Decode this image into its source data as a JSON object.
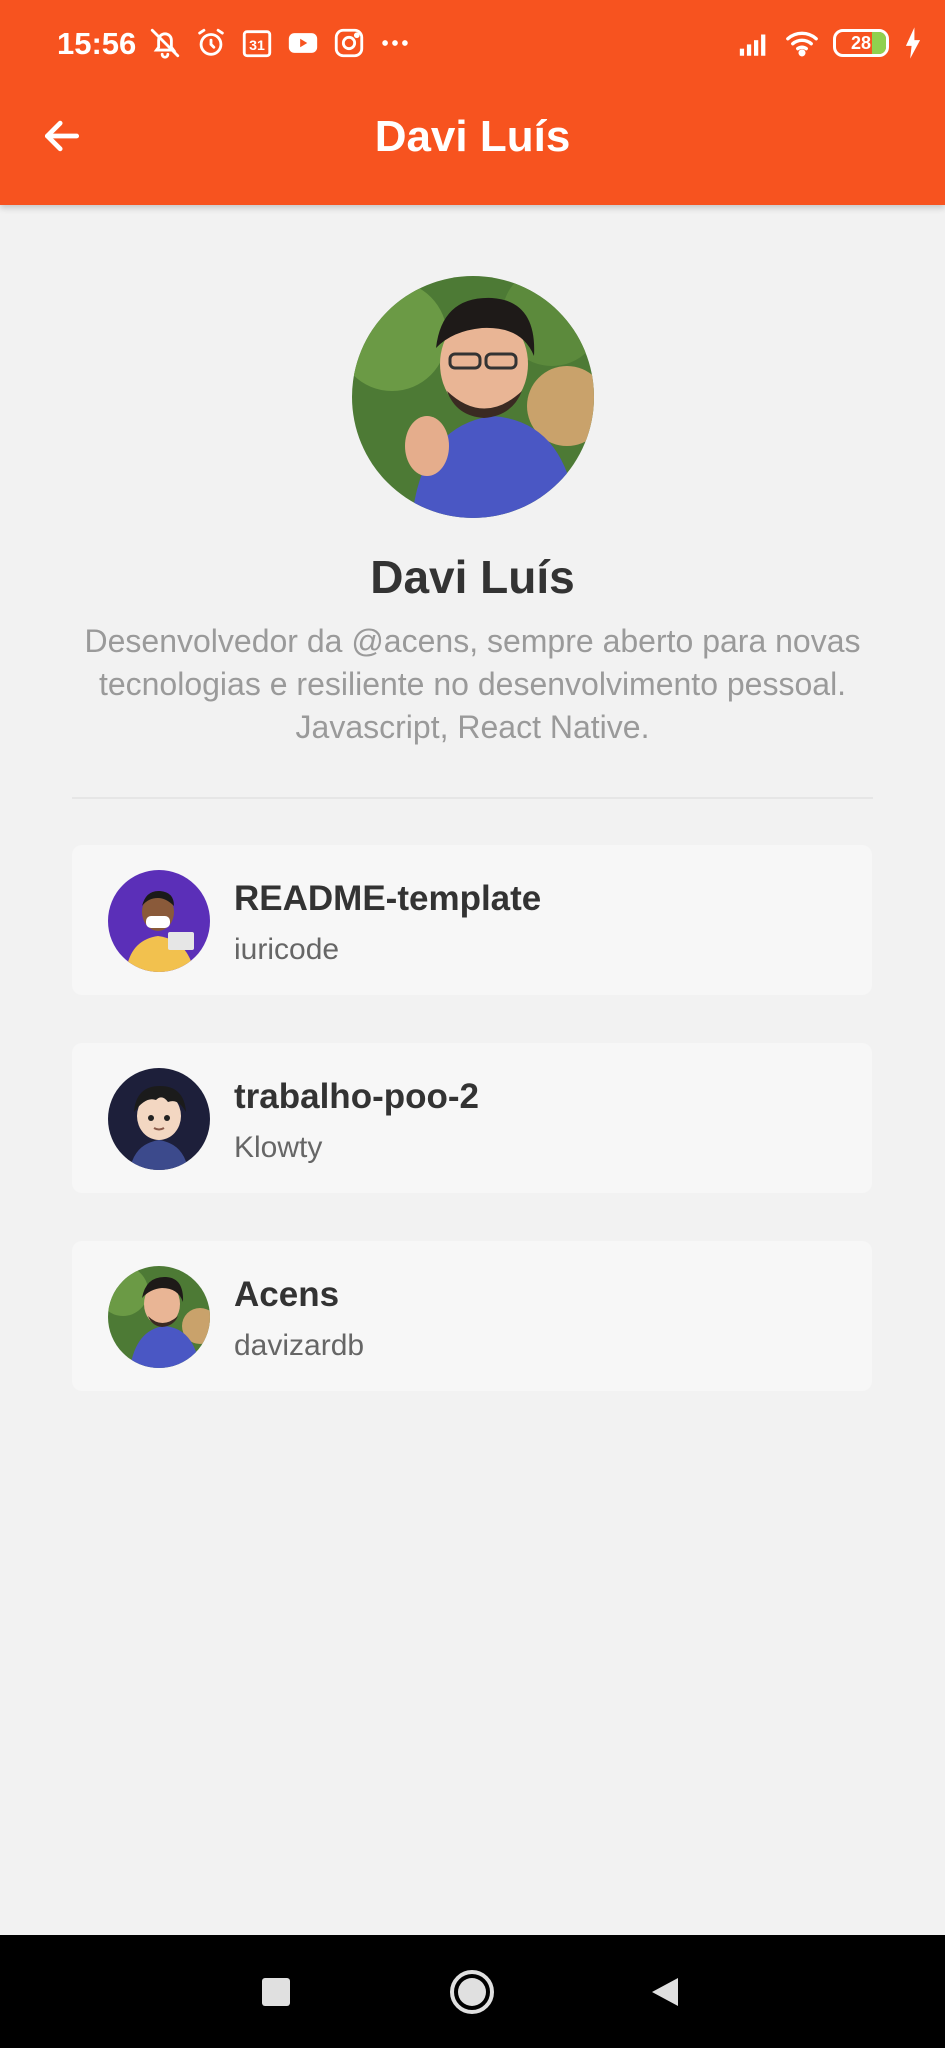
{
  "status_bar": {
    "time": "15:56",
    "left_icons": [
      "bell-off-icon",
      "alarm-icon",
      "calendar-icon",
      "youtube-icon",
      "instagram-icon",
      "more-dots-icon"
    ],
    "calendar_day": "31",
    "battery_level": "28",
    "right_icons": [
      "signal-icon",
      "wifi-icon",
      "battery-icon",
      "charging-icon"
    ]
  },
  "header": {
    "title": "Davi Luís",
    "back_icon": "arrow-left-icon",
    "background_color": "#f7531f"
  },
  "profile": {
    "name": "Davi Luís",
    "bio": "Desenvolvedor da @acens, sempre aberto para novas tecnologias e resiliente no desenvolvimento pessoal. Javascript, React Native."
  },
  "repositories": [
    {
      "title": "README-template",
      "owner": "iuricode",
      "avatar": "avatar-iuricode"
    },
    {
      "title": "trabalho-poo-2",
      "owner": "Klowty",
      "avatar": "avatar-klowty"
    },
    {
      "title": "Acens",
      "owner": "davizardb",
      "avatar": "avatar-davizardb"
    }
  ],
  "nav_bar": {
    "buttons": [
      "recent-apps-icon",
      "home-icon",
      "back-triangle-icon"
    ]
  }
}
